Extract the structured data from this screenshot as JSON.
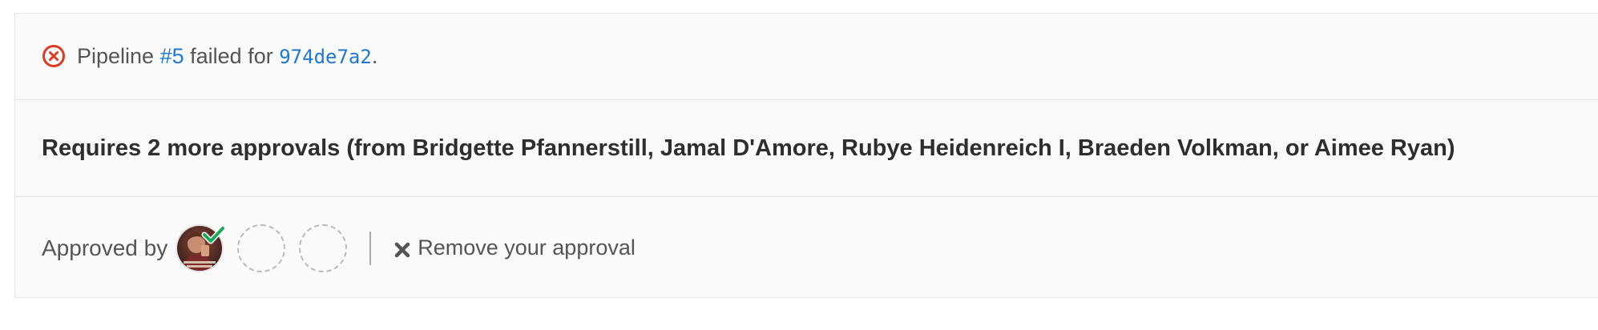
{
  "pipeline": {
    "prefix": "Pipeline",
    "number": "#5",
    "middle": "failed for",
    "commit": "974de7a2",
    "suffix": ".",
    "status_icon": "status-failed-icon",
    "status_color": "#db3b21"
  },
  "approvals": {
    "requirement_text": "Requires 2 more approvals (from Bridgette Pfannerstill, Jamal D'Amore, Rubye Heidenreich I, Braeden Volkman, or Aimee Ryan)",
    "approved_by_label": "Approved by",
    "approvers": [
      {
        "type": "user-avatar",
        "approved": true,
        "badge_icon": "check-icon",
        "badge_color": "#1aaa55"
      },
      {
        "type": "placeholder"
      },
      {
        "type": "placeholder"
      }
    ],
    "remove_label": "Remove your approval",
    "remove_icon": "close-icon"
  },
  "colors": {
    "link": "#1f78d1",
    "panel_background": "#fafafa",
    "border": "#e5e5e5"
  }
}
